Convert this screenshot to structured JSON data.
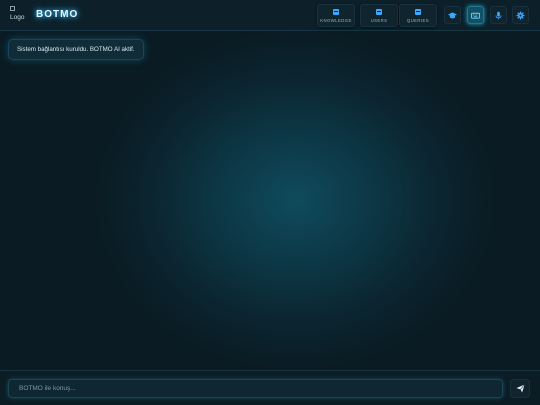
{
  "header": {
    "logo_alt": "Logo",
    "brand": "BOTMO",
    "nav": [
      {
        "label": "KNOWLEDGE",
        "icon": "database-icon"
      },
      {
        "label": "USERS",
        "icon": "database-icon"
      },
      {
        "label": "QUERIES",
        "icon": "database-icon"
      }
    ],
    "actions": [
      {
        "icon": "graduation-cap-icon",
        "active": false
      },
      {
        "icon": "keyboard-icon",
        "active": true
      },
      {
        "icon": "microphone-icon",
        "active": false
      },
      {
        "icon": "gear-icon",
        "active": false
      }
    ]
  },
  "messages": [
    {
      "text": "Sistem bağlantısı kuruldu. BOTMO AI aktif."
    }
  ],
  "composer": {
    "placeholder": "BOTMO ile konuş...",
    "value": "",
    "send_icon": "paper-plane-icon"
  },
  "colors": {
    "accent": "#3fa8ff",
    "glow": "#1aa6c9",
    "background": "#0a1b23"
  }
}
